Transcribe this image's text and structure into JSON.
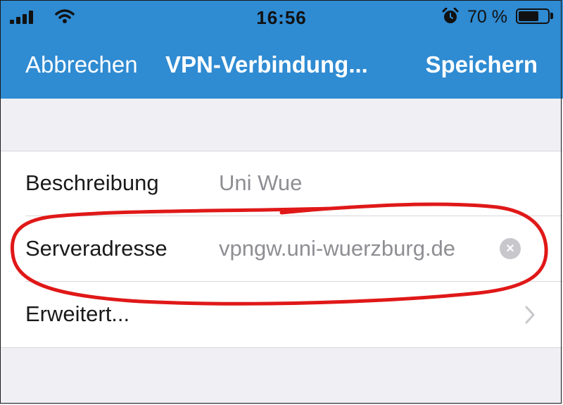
{
  "status_bar": {
    "time": "16:56",
    "battery_percent": "70 %",
    "battery_level": 0.7,
    "icons": [
      "signal-icon",
      "wifi-icon",
      "alarm-icon",
      "battery-icon"
    ]
  },
  "nav": {
    "cancel_label": "Abbrechen",
    "title": "VPN-Verbindung...",
    "save_label": "Speichern"
  },
  "form": {
    "rows": [
      {
        "label": "Beschreibung",
        "value": "Uni Wue"
      },
      {
        "label": "Serveradresse",
        "value": "vpngw.uni-wuerzburg.de"
      },
      {
        "label": "Erweitert..."
      }
    ]
  },
  "colors": {
    "nav_background": "#2f8bd2",
    "annotation": "#e01818",
    "page_background": "#efeff4"
  }
}
